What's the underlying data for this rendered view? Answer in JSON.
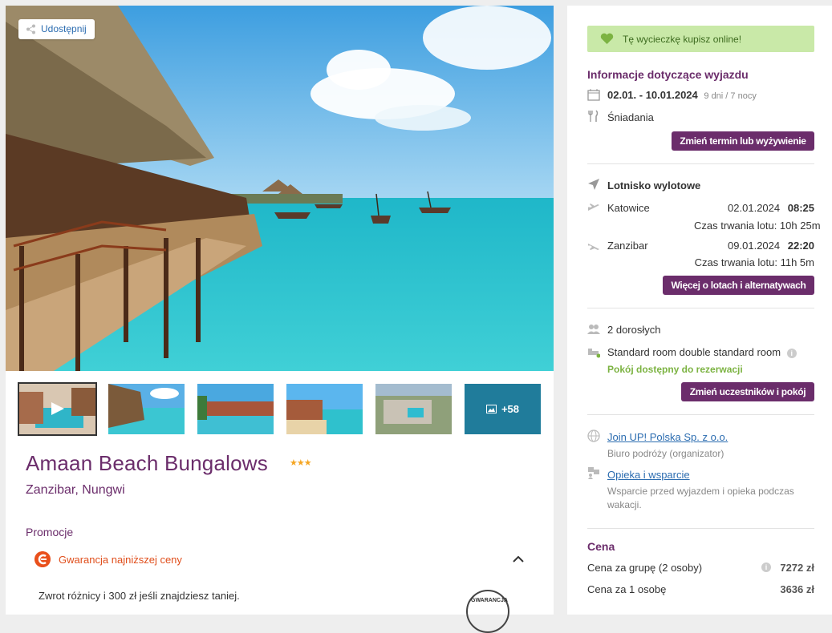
{
  "share": {
    "label": "Udostępnij"
  },
  "gallery": {
    "more_label": "+58"
  },
  "hotel": {
    "name": "Amaan Beach Bungalows",
    "stars": "★★★",
    "location": "Zanzibar, Nungwi"
  },
  "promo": {
    "title": "Promocje",
    "guarantee_label": "Gwarancja najniższej ceny",
    "description": "Zwrot różnicy i 300 zł jeśli znajdziesz taniej.",
    "badge_text": "GWARANCJA"
  },
  "online": {
    "label": "Tę wycieczkę kupisz online!"
  },
  "trip": {
    "title": "Informacje dotyczące wyjazdu",
    "dates": "02.01. - 10.01.2024",
    "duration": "9 dni / 7 nocy",
    "board": "Śniadania",
    "change_button": "Zmień termin lub wyżywienie"
  },
  "flights": {
    "airport_label": "Lotnisko wylotowe",
    "outbound": {
      "city": "Katowice",
      "date": "02.01.2024",
      "time": "08:25",
      "duration": "Czas trwania lotu: 10h 25m"
    },
    "return": {
      "city": "Zanzibar",
      "date": "09.01.2024",
      "time": "22:20",
      "duration": "Czas trwania lotu: 11h 5m"
    },
    "more_button": "Więcej o lotach i alternatywach"
  },
  "room": {
    "guests": "2 dorosłych",
    "room_name": "Standard room double standard room",
    "availability": "Pokój dostępny do rezerwacji",
    "change_button": "Zmień uczestników i pokój"
  },
  "organizer": {
    "name": "Join UP! Polska Sp. z o.o.",
    "role": "Biuro podróży (organizator)",
    "care_link": "Opieka i wsparcie",
    "care_desc_1": "Wsparcie przed wyjazdem i opieka podczas",
    "care_desc_2": "wakacji."
  },
  "price": {
    "title": "Cena",
    "group_label": "Cena za grupę (2 osoby)",
    "group_value": "7272 zł",
    "person_label": "Cena za 1 osobę",
    "person_value": "3636 zł"
  },
  "colors": {
    "accent": "#6b2d6b",
    "online_bg": "#c9e9a8",
    "promo": "#e04e1b",
    "link": "#2b6cb0"
  }
}
